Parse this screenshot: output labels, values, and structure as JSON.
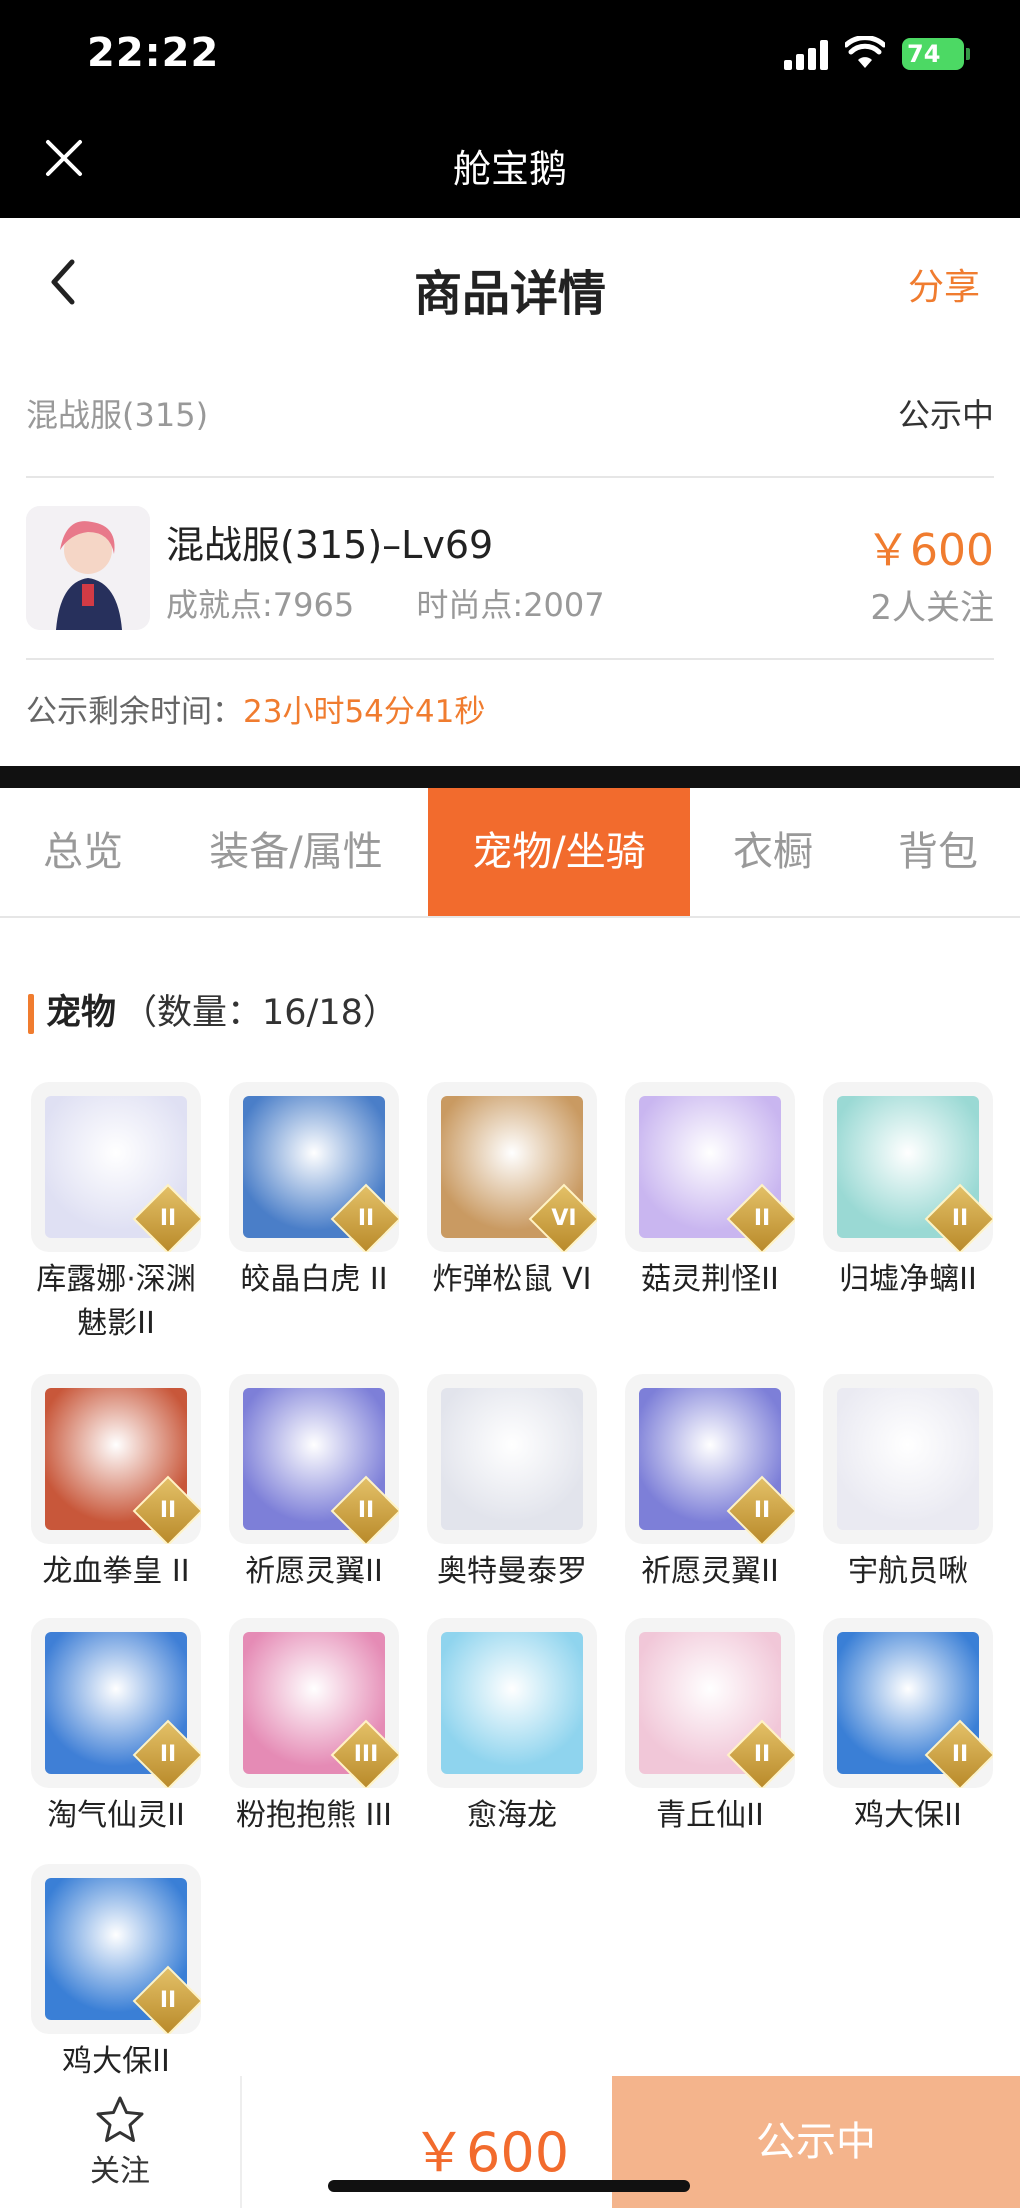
{
  "status_bar": {
    "time": "22:22",
    "battery": "74"
  },
  "mini_app": {
    "title": "舱宝鹅"
  },
  "nav": {
    "title": "商品详情",
    "share": "分享"
  },
  "listing": {
    "server": "混战服(315)",
    "status": "公示中",
    "title": "混战服(315)–Lv69",
    "achievement": "成就点:7965",
    "fashion": "时尚点:2007",
    "price": "￥600",
    "followers": "2人关注",
    "remaining_label": "公示剩余时间：",
    "remaining_value": "23小时54分41秒"
  },
  "tabs": [
    {
      "label": "总览",
      "active": false
    },
    {
      "label": "装备/属性",
      "active": false
    },
    {
      "label": "宠物/坐骑",
      "active": true
    },
    {
      "label": "衣橱",
      "active": false
    },
    {
      "label": "背包",
      "active": false
    }
  ],
  "section": {
    "title": "宠物",
    "count": "（数量：16/18）"
  },
  "pets": [
    {
      "name": "库露娜·深渊魅影II",
      "badge": "II",
      "color": "#dfe0f3"
    },
    {
      "name": "皎晶白虎 II",
      "badge": "II",
      "color": "#4a7ec8"
    },
    {
      "name": "炸弹松鼠 VI",
      "badge": "VI",
      "color": "#c99a62"
    },
    {
      "name": "菇灵荆怪II",
      "badge": "II",
      "color": "#c9b6f0"
    },
    {
      "name": "归墟净螭II",
      "badge": "II",
      "color": "#9ad9d4"
    },
    {
      "name": "龙血拳皇 II",
      "badge": "II",
      "color": "#c8573a"
    },
    {
      "name": "祈愿灵翼II",
      "badge": "II",
      "color": "#7d7fd8"
    },
    {
      "name": "奥特曼泰罗",
      "badge": "",
      "color": "#e2e4ec"
    },
    {
      "name": "祈愿灵翼II",
      "badge": "II",
      "color": "#7d7fd8"
    },
    {
      "name": "宇航员啾",
      "badge": "",
      "color": "#eaeaf2"
    },
    {
      "name": "淘气仙灵II",
      "badge": "II",
      "color": "#3f7fd6"
    },
    {
      "name": "粉抱抱熊 III",
      "badge": "III",
      "color": "#e58bb5"
    },
    {
      "name": "愈海龙",
      "badge": "",
      "color": "#8fd4ee"
    },
    {
      "name": "青丘仙II",
      "badge": "II",
      "color": "#f1c7d8"
    },
    {
      "name": "鸡大保II",
      "badge": "II",
      "color": "#3a7fd6"
    },
    {
      "name": "鸡大保II",
      "badge": "II",
      "color": "#3a7fd6"
    }
  ],
  "footer": {
    "follow_label": "关注",
    "price": "￥600",
    "status": "公示中"
  },
  "colors": {
    "accent": "#f26b2d",
    "footer_disabled": "#f4b48c"
  }
}
